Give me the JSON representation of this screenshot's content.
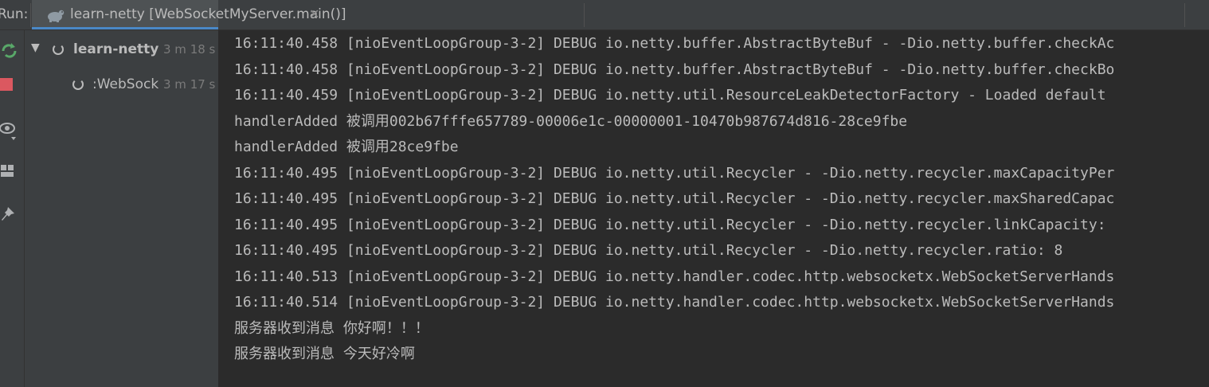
{
  "tabbar": {
    "run_label": "Run:",
    "tab": {
      "title": "learn-netty [WebSocketMyServer.main()]",
      "icon": "java-app-icon",
      "close": "✕"
    }
  },
  "toolbar": {
    "items": [
      {
        "name": "rerun-icon",
        "color": "#59a869"
      },
      {
        "name": "stop-icon",
        "color": "#db5860"
      },
      {
        "name": "eye-icon",
        "color": "#afb1b3"
      },
      {
        "name": "layout-icon",
        "color": "#afb1b3"
      },
      {
        "name": "pin-icon",
        "color": "#afb1b3"
      }
    ]
  },
  "tree": {
    "root": {
      "label": "learn-netty [",
      "time": "3 m 18 s"
    },
    "child": {
      "label": ":WebSock",
      "time": "3 m 17 s"
    }
  },
  "console": {
    "lines": [
      "16:11:40.458 [nioEventLoopGroup-3-2] DEBUG io.netty.buffer.AbstractByteBuf - -Dio.netty.buffer.checkAc",
      "16:11:40.458 [nioEventLoopGroup-3-2] DEBUG io.netty.buffer.AbstractByteBuf - -Dio.netty.buffer.checkBo",
      "16:11:40.459 [nioEventLoopGroup-3-2] DEBUG io.netty.util.ResourceLeakDetectorFactory - Loaded default",
      "handlerAdded 被调用002b67fffe657789-00006e1c-00000001-10470b987674d816-28ce9fbe",
      "handlerAdded 被调用28ce9fbe",
      "16:11:40.495 [nioEventLoopGroup-3-2] DEBUG io.netty.util.Recycler - -Dio.netty.recycler.maxCapacityPer",
      "16:11:40.495 [nioEventLoopGroup-3-2] DEBUG io.netty.util.Recycler - -Dio.netty.recycler.maxSharedCapac",
      "16:11:40.495 [nioEventLoopGroup-3-2] DEBUG io.netty.util.Recycler - -Dio.netty.recycler.linkCapacity:",
      "16:11:40.495 [nioEventLoopGroup-3-2] DEBUG io.netty.util.Recycler - -Dio.netty.recycler.ratio: 8",
      "16:11:40.513 [nioEventLoopGroup-3-2] DEBUG io.netty.handler.codec.http.websocketx.WebSocketServerHands",
      "16:11:40.514 [nioEventLoopGroup-3-2] DEBUG io.netty.handler.codec.http.websocketx.WebSocketServerHands",
      "服务器收到消息 你好啊！！！",
      "服务器收到消息 今天好冷啊"
    ]
  }
}
